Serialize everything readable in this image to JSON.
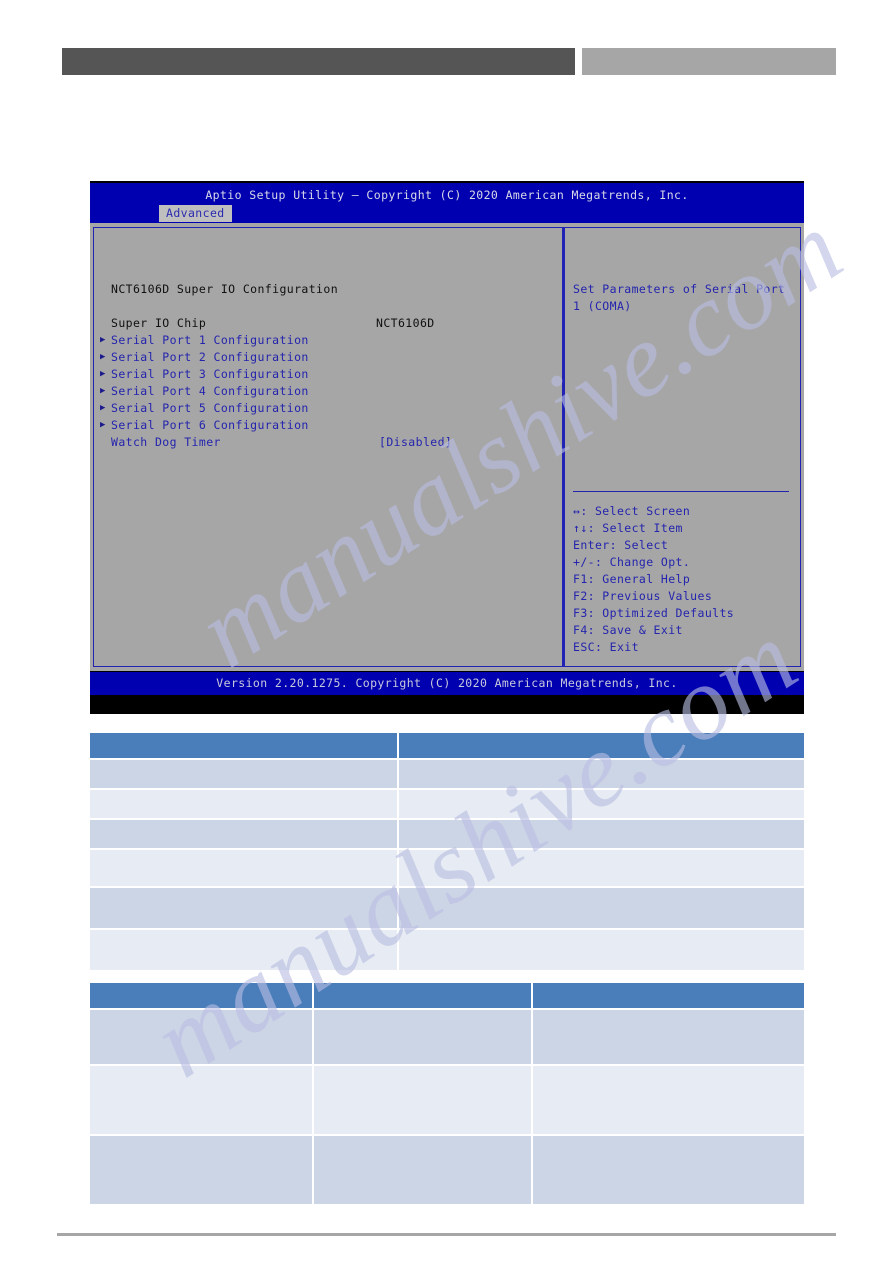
{
  "header": {
    "bar_left_label": "",
    "bar_right_label": ""
  },
  "bios": {
    "title": "Aptio Setup Utility – Copyright (C) 2020 American Megatrends, Inc.",
    "active_tab": "Advanced",
    "tabs": [
      "Advanced"
    ],
    "section_heading": "NCT6106D Super IO Configuration",
    "info_rows": [
      {
        "label": "Super IO Chip",
        "value": "NCT6106D"
      }
    ],
    "menu_items": [
      {
        "label": "Serial Port 1 Configuration",
        "arrow": "▶",
        "submenu": true,
        "value": ""
      },
      {
        "label": "Serial Port 2 Configuration",
        "arrow": "▶",
        "submenu": true,
        "value": ""
      },
      {
        "label": "Serial Port 3 Configuration",
        "arrow": "▶",
        "submenu": true,
        "value": ""
      },
      {
        "label": "Serial Port 4 Configuration",
        "arrow": "▶",
        "submenu": true,
        "value": ""
      },
      {
        "label": "Serial Port 5 Configuration",
        "arrow": "▶",
        "submenu": true,
        "value": ""
      },
      {
        "label": "Serial Port 6 Configuration",
        "arrow": "▶",
        "submenu": true,
        "value": ""
      },
      {
        "label": "Watch Dog Timer",
        "arrow": "",
        "submenu": false,
        "value": "[Disabled]"
      }
    ],
    "help": {
      "line1": "Set Parameters of Serial Port",
      "line2": "1 (COMA)"
    },
    "key_help": [
      "↔: Select Screen",
      "↑↓: Select Item",
      "Enter: Select",
      "+/-: Change Opt.",
      "F1: General Help",
      "F2: Previous Values",
      "F3: Optimized Defaults",
      "F4: Save & Exit",
      "ESC: Exit"
    ],
    "footer": "Version 2.20.1275. Copyright (C) 2020 American Megatrends, Inc."
  },
  "table_one": {
    "headers": [
      "",
      ""
    ],
    "rows": [
      [
        "",
        ""
      ],
      [
        "",
        ""
      ],
      [
        "",
        ""
      ],
      [
        "",
        ""
      ],
      [
        "",
        ""
      ],
      [
        "",
        ""
      ]
    ]
  },
  "table_two": {
    "headers": [
      "",
      "",
      ""
    ],
    "rows": [
      [
        "",
        "",
        ""
      ],
      [
        "",
        "",
        ""
      ],
      [
        "",
        "",
        ""
      ]
    ]
  },
  "watermark": {
    "text_a": "manualshive.com",
    "text_b": "manualshive.com"
  },
  "colors": {
    "bios_blue": "#0000b0",
    "bios_gray": "#a6a6a6",
    "bios_text_blue": "#2424ae",
    "table_header": "#4a7ebb",
    "table_row_dark": "#ccd5e5",
    "table_row_light": "#e7ebf3",
    "header_bar_dark": "#555555",
    "header_bar_light": "#a6a6a6"
  }
}
